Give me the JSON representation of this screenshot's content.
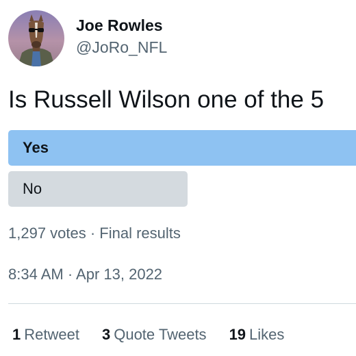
{
  "author": {
    "display_name": "Joe Rowles",
    "handle": "@JoRo_NFL",
    "avatar_icon": "horse-avatar-icon"
  },
  "tweet": {
    "text": "Is Russell Wilson one of the 5"
  },
  "poll": {
    "options": [
      {
        "label": "Yes",
        "winner": true
      },
      {
        "label": "No",
        "winner": false
      }
    ],
    "votes_text": "1,297 votes · Final results"
  },
  "timestamp": "8:34 AM · Apr 13, 2022",
  "stats": {
    "retweets": {
      "count": "1",
      "label": "Retweet"
    },
    "quotes": {
      "count": "3",
      "label": "Quote Tweets"
    },
    "likes": {
      "count": "19",
      "label": "Likes"
    }
  },
  "colors": {
    "winner_bar": "#8ec2f2",
    "other_bar": "#d4dadf",
    "secondary_text": "#536471"
  }
}
